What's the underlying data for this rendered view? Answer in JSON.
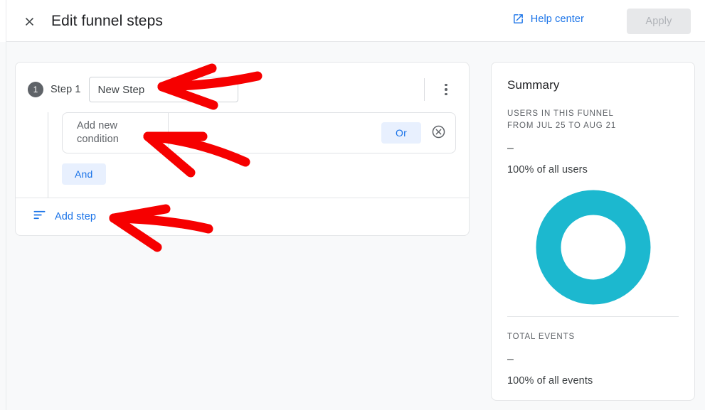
{
  "header": {
    "close_icon": "close-icon",
    "title": "Edit funnel steps",
    "help_label": "Help center",
    "help_icon": "open-in-new-icon",
    "apply_label": "Apply"
  },
  "steps": {
    "items": [
      {
        "number": "1",
        "label": "Step 1",
        "name_value": "New Step",
        "name_placeholder": "New Step",
        "menu_icon": "more-vert-icon",
        "condition": {
          "select_line1": "Add new",
          "select_line2": "condition",
          "caret_icon": "chevron-down-icon",
          "or_label": "Or",
          "remove_icon": "remove-circle-icon"
        },
        "and_label": "And"
      }
    ],
    "add_step_label": "Add step",
    "add_step_icon": "add-step-lines-icon"
  },
  "summary": {
    "title": "Summary",
    "users_kicker_line1": "USERS IN THIS FUNNEL",
    "users_kicker_line2": "FROM JUL 25 TO AUG 21",
    "users_value": "–",
    "users_percent": "100% of all users",
    "events_kicker": "TOTAL EVENTS",
    "events_value": "–",
    "events_percent": "100% of all events"
  },
  "chart_data": {
    "type": "pie",
    "title": "Users in this funnel",
    "categories": [
      "Users in this funnel"
    ],
    "values": [
      100
    ],
    "labels": [
      "100% of all users"
    ],
    "donut": true,
    "colors": [
      "#1cb8cf"
    ],
    "legend": "none"
  },
  "colors": {
    "accent_blue": "#1a73e8",
    "chip_bg": "#e8f0fe",
    "donut_teal": "#1cb8cf",
    "badge_gray": "#5f6368",
    "page_bg": "#f8f9fa",
    "annotation_red": "#f60000"
  },
  "annotations": {
    "arrow_1": "red-arrow-pointing-to-step-name-input",
    "arrow_2": "red-arrow-pointing-to-condition-dropdown",
    "arrow_3": "red-arrow-pointing-to-add-step"
  }
}
